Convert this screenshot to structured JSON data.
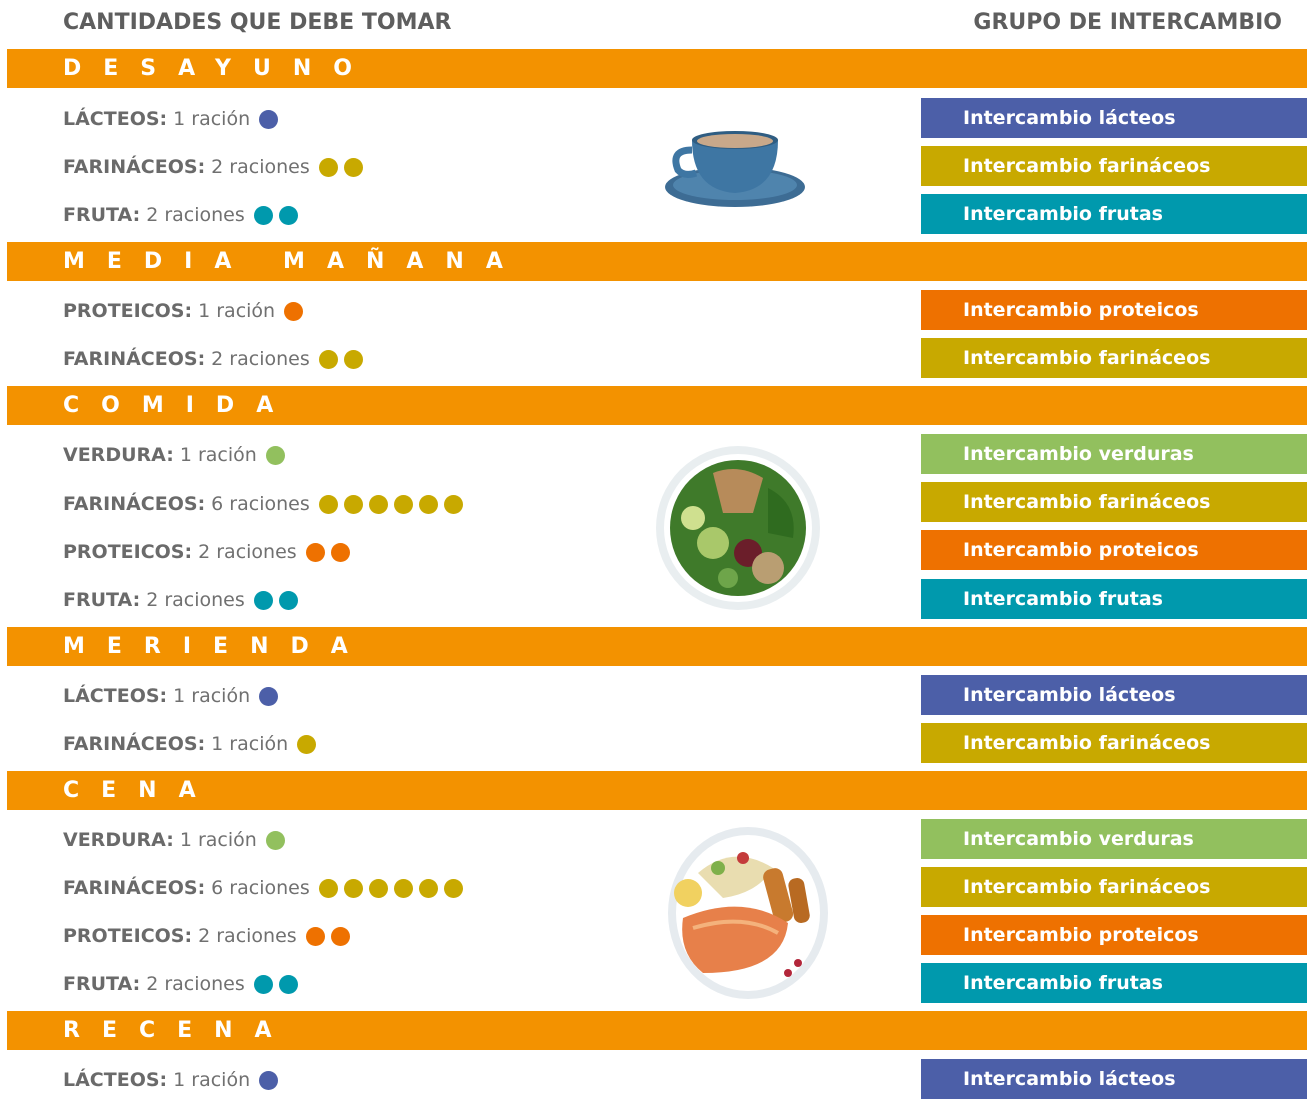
{
  "headers": {
    "left": "CANTIDADES QUE DEBE TOMAR",
    "right": "GRUPO DE INTERCAMBIO"
  },
  "colors": {
    "meal_bar": "#f39200",
    "lacteos": "#4c5fa8",
    "farinaceos": "#c8a900",
    "frutas": "#0099ad",
    "proteicos": "#ee7100",
    "verduras": "#92c05e"
  },
  "meals": [
    {
      "title": "DESAYUNO",
      "image": "coffee-cup",
      "items": [
        {
          "category": "LÁCTEOS:",
          "amount": "1 ración",
          "count": 1,
          "group": "lacteos",
          "exchange": "Intercambio lácteos"
        },
        {
          "category": "FARINÁCEOS:",
          "amount": "2 raciones",
          "count": 2,
          "group": "farinaceos",
          "exchange": "Intercambio farináceos"
        },
        {
          "category": "FRUTA:",
          "amount": "2 raciones",
          "count": 2,
          "group": "frutas",
          "exchange": "Intercambio frutas"
        }
      ]
    },
    {
      "title": "MEDIA MAÑANA",
      "items": [
        {
          "category": "PROTEICOS:",
          "amount": "1 ración",
          "count": 1,
          "group": "proteicos",
          "exchange": "Intercambio proteicos"
        },
        {
          "category": "FARINÁCEOS:",
          "amount": "2 raciones",
          "count": 2,
          "group": "farinaceos",
          "exchange": "Intercambio farináceos"
        }
      ]
    },
    {
      "title": "COMIDA",
      "image": "salad-bowl",
      "items": [
        {
          "category": "VERDURA:",
          "amount": "1 ración",
          "count": 1,
          "group": "verduras",
          "exchange": "Intercambio verduras"
        },
        {
          "category": "FARINÁCEOS:",
          "amount": "6 raciones",
          "count": 6,
          "group": "farinaceos",
          "exchange": "Intercambio farináceos"
        },
        {
          "category": "PROTEICOS:",
          "amount": "2 raciones",
          "count": 2,
          "group": "proteicos",
          "exchange": "Intercambio proteicos"
        },
        {
          "category": "FRUTA:",
          "amount": "2 raciones",
          "count": 2,
          "group": "frutas",
          "exchange": "Intercambio frutas"
        }
      ]
    },
    {
      "title": "MERIENDA",
      "items": [
        {
          "category": "LÁCTEOS:",
          "amount": "1 ración",
          "count": 1,
          "group": "lacteos",
          "exchange": "Intercambio lácteos"
        },
        {
          "category": "FARINÁCEOS:",
          "amount": "1 ración",
          "count": 1,
          "group": "farinaceos",
          "exchange": "Intercambio farináceos"
        }
      ]
    },
    {
      "title": "CENA",
      "image": "salmon-plate",
      "items": [
        {
          "category": "VERDURA:",
          "amount": "1 ración",
          "count": 1,
          "group": "verduras",
          "exchange": "Intercambio verduras"
        },
        {
          "category": "FARINÁCEOS:",
          "amount": "6 raciones",
          "count": 6,
          "group": "farinaceos",
          "exchange": "Intercambio farináceos"
        },
        {
          "category": "PROTEICOS:",
          "amount": "2 raciones",
          "count": 2,
          "group": "proteicos",
          "exchange": "Intercambio proteicos"
        },
        {
          "category": "FRUTA:",
          "amount": "2 raciones",
          "count": 2,
          "group": "frutas",
          "exchange": "Intercambio frutas"
        }
      ]
    },
    {
      "title": "RECENA",
      "items": [
        {
          "category": "LÁCTEOS:",
          "amount": "1 ración",
          "count": 1,
          "group": "lacteos",
          "exchange": "Intercambio lácteos"
        }
      ]
    }
  ]
}
